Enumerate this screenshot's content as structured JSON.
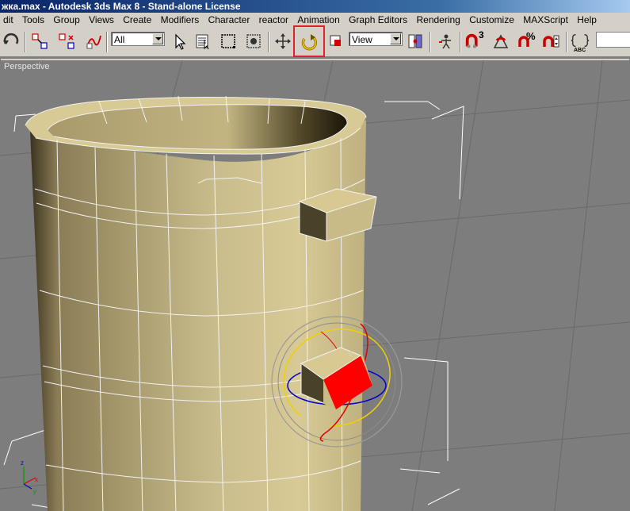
{
  "window": {
    "title": "жка.max - Autodesk 3ds Max 8 - Stand-alone License"
  },
  "menu": {
    "items": [
      "dit",
      "Tools",
      "Group",
      "Views",
      "Create",
      "Modifiers",
      "Character",
      "reactor",
      "Animation",
      "Graph Editors",
      "Rendering",
      "Customize",
      "MAXScript",
      "Help"
    ]
  },
  "toolbar": {
    "selection_filter": "All",
    "reference_coord": "View",
    "icons": [
      "undo-icon",
      "select-and-link-icon",
      "unlink-icon",
      "bind-space-warp-icon",
      "select-object-icon",
      "select-by-name-icon",
      "rectangular-selection-icon",
      "window-crossing-icon",
      "select-and-move-icon",
      "select-and-rotate-icon",
      "select-and-scale-icon",
      "use-pivot-center-icon",
      "mirror-icon",
      "align-icon",
      "snap-3d-icon",
      "angle-snap-icon",
      "percent-snap-icon",
      "spinner-snap-icon",
      "edit-named-selections-icon"
    ],
    "snap_label": "3",
    "percent_label": "%",
    "abc_label": "ABC"
  },
  "viewport": {
    "label": "Perspective"
  },
  "colors": {
    "accent_highlight": "#e0202b",
    "object": "#b5a67a",
    "gizmo_x": "#e00000",
    "gizmo_y": "#f0d000",
    "gizmo_z": "#0000cc"
  }
}
